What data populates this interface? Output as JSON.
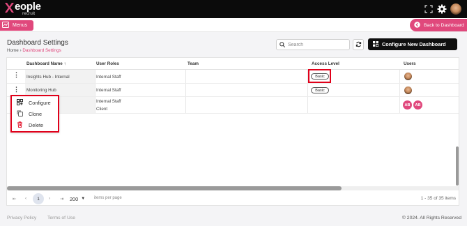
{
  "brand": {
    "name": "eople",
    "sub": "recruit",
    "color": "#e0487c"
  },
  "header_icons": [
    "fullscreen-icon",
    "gear-icon",
    "avatar"
  ],
  "menus_label": "Menus",
  "back_label": "Back to Dashboard",
  "page": {
    "title": "Dashboard Settings",
    "breadcrumb_home": "Home",
    "breadcrumb_sep": " › ",
    "breadcrumb_current": "Dashboard Settings"
  },
  "search": {
    "placeholder": "Search",
    "value": ""
  },
  "configure_button": "Configure New Dashboard",
  "table": {
    "columns": [
      "Dashboard Name",
      "User Roles",
      "Team",
      "Access Level",
      "Users"
    ],
    "sort_indicator": "↑",
    "rows": [
      {
        "name": "Insights Hub - Internal",
        "roles": [
          "Internal Staff"
        ],
        "team": "",
        "access": "Basic",
        "users": [
          "photo"
        ]
      },
      {
        "name": "Monitoring Hub",
        "roles": [
          "Internal Staff"
        ],
        "team": "",
        "access": "Basic",
        "users": [
          "photo"
        ]
      },
      {
        "name": "",
        "roles": [
          "Internal Staff",
          "Client"
        ],
        "team": "",
        "access": "",
        "users": [
          "AB",
          "AB"
        ]
      }
    ]
  },
  "context_menu": [
    {
      "label": "Configure",
      "icon": "configure-icon"
    },
    {
      "label": "Clone",
      "icon": "clone-icon"
    },
    {
      "label": "Delete",
      "icon": "delete-icon"
    }
  ],
  "pagination": {
    "current_page": "1",
    "page_size": "200",
    "per_page_label": "items per page",
    "info": "1 - 35 of 35 items"
  },
  "footer": {
    "privacy": "Privacy Policy",
    "terms": "Terms of Use",
    "copyright": "© 2024. All Rights Reserved"
  }
}
